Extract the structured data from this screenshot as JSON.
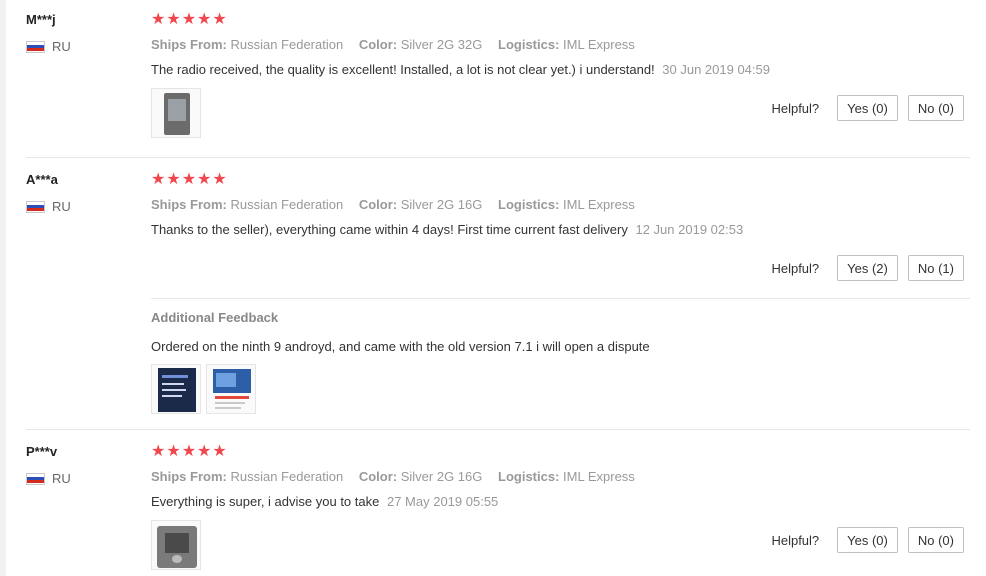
{
  "helpful_label": "Helpful?",
  "reviews": [
    {
      "user": "M***j",
      "country": "RU",
      "stars": 5,
      "ships_from_label": "Ships From:",
      "ships_from": "Russian Federation",
      "color_label": "Color:",
      "color": "Silver 2G 32G",
      "logistics_label": "Logistics:",
      "logistics": "IML Express",
      "text": "The radio received, the quality is excellent! Installed, a lot is not clear yet.) i understand!",
      "date": "30 Jun 2019 04:59",
      "yes": "Yes (0)",
      "no": "No (0)"
    },
    {
      "user": "A***a",
      "country": "RU",
      "stars": 5,
      "ships_from_label": "Ships From:",
      "ships_from": "Russian Federation",
      "color_label": "Color:",
      "color": "Silver 2G 16G",
      "logistics_label": "Logistics:",
      "logistics": "IML Express",
      "text": "Thanks to the seller), everything came within 4 days! First time current fast delivery",
      "date": "12 Jun 2019 02:53",
      "yes": "Yes (2)",
      "no": "No (1)",
      "additional": {
        "title": "Additional Feedback",
        "text": "Ordered on the ninth 9 androyd, and came with the old version 7.1 i will open a dispute"
      }
    },
    {
      "user": "P***v",
      "country": "RU",
      "stars": 5,
      "ships_from_label": "Ships From:",
      "ships_from": "Russian Federation",
      "color_label": "Color:",
      "color": "Silver 2G 16G",
      "logistics_label": "Logistics:",
      "logistics": "IML Express",
      "text": "Everything is super, i advise you to take",
      "date": "27 May 2019 05:55",
      "yes": "Yes (0)",
      "no": "No (0)"
    }
  ],
  "colors": {
    "star": "#f0474d",
    "muted": "#999999",
    "divider": "#e8e8e8"
  },
  "icons": {
    "star": "star-icon",
    "flag": "russia-flag-icon"
  }
}
